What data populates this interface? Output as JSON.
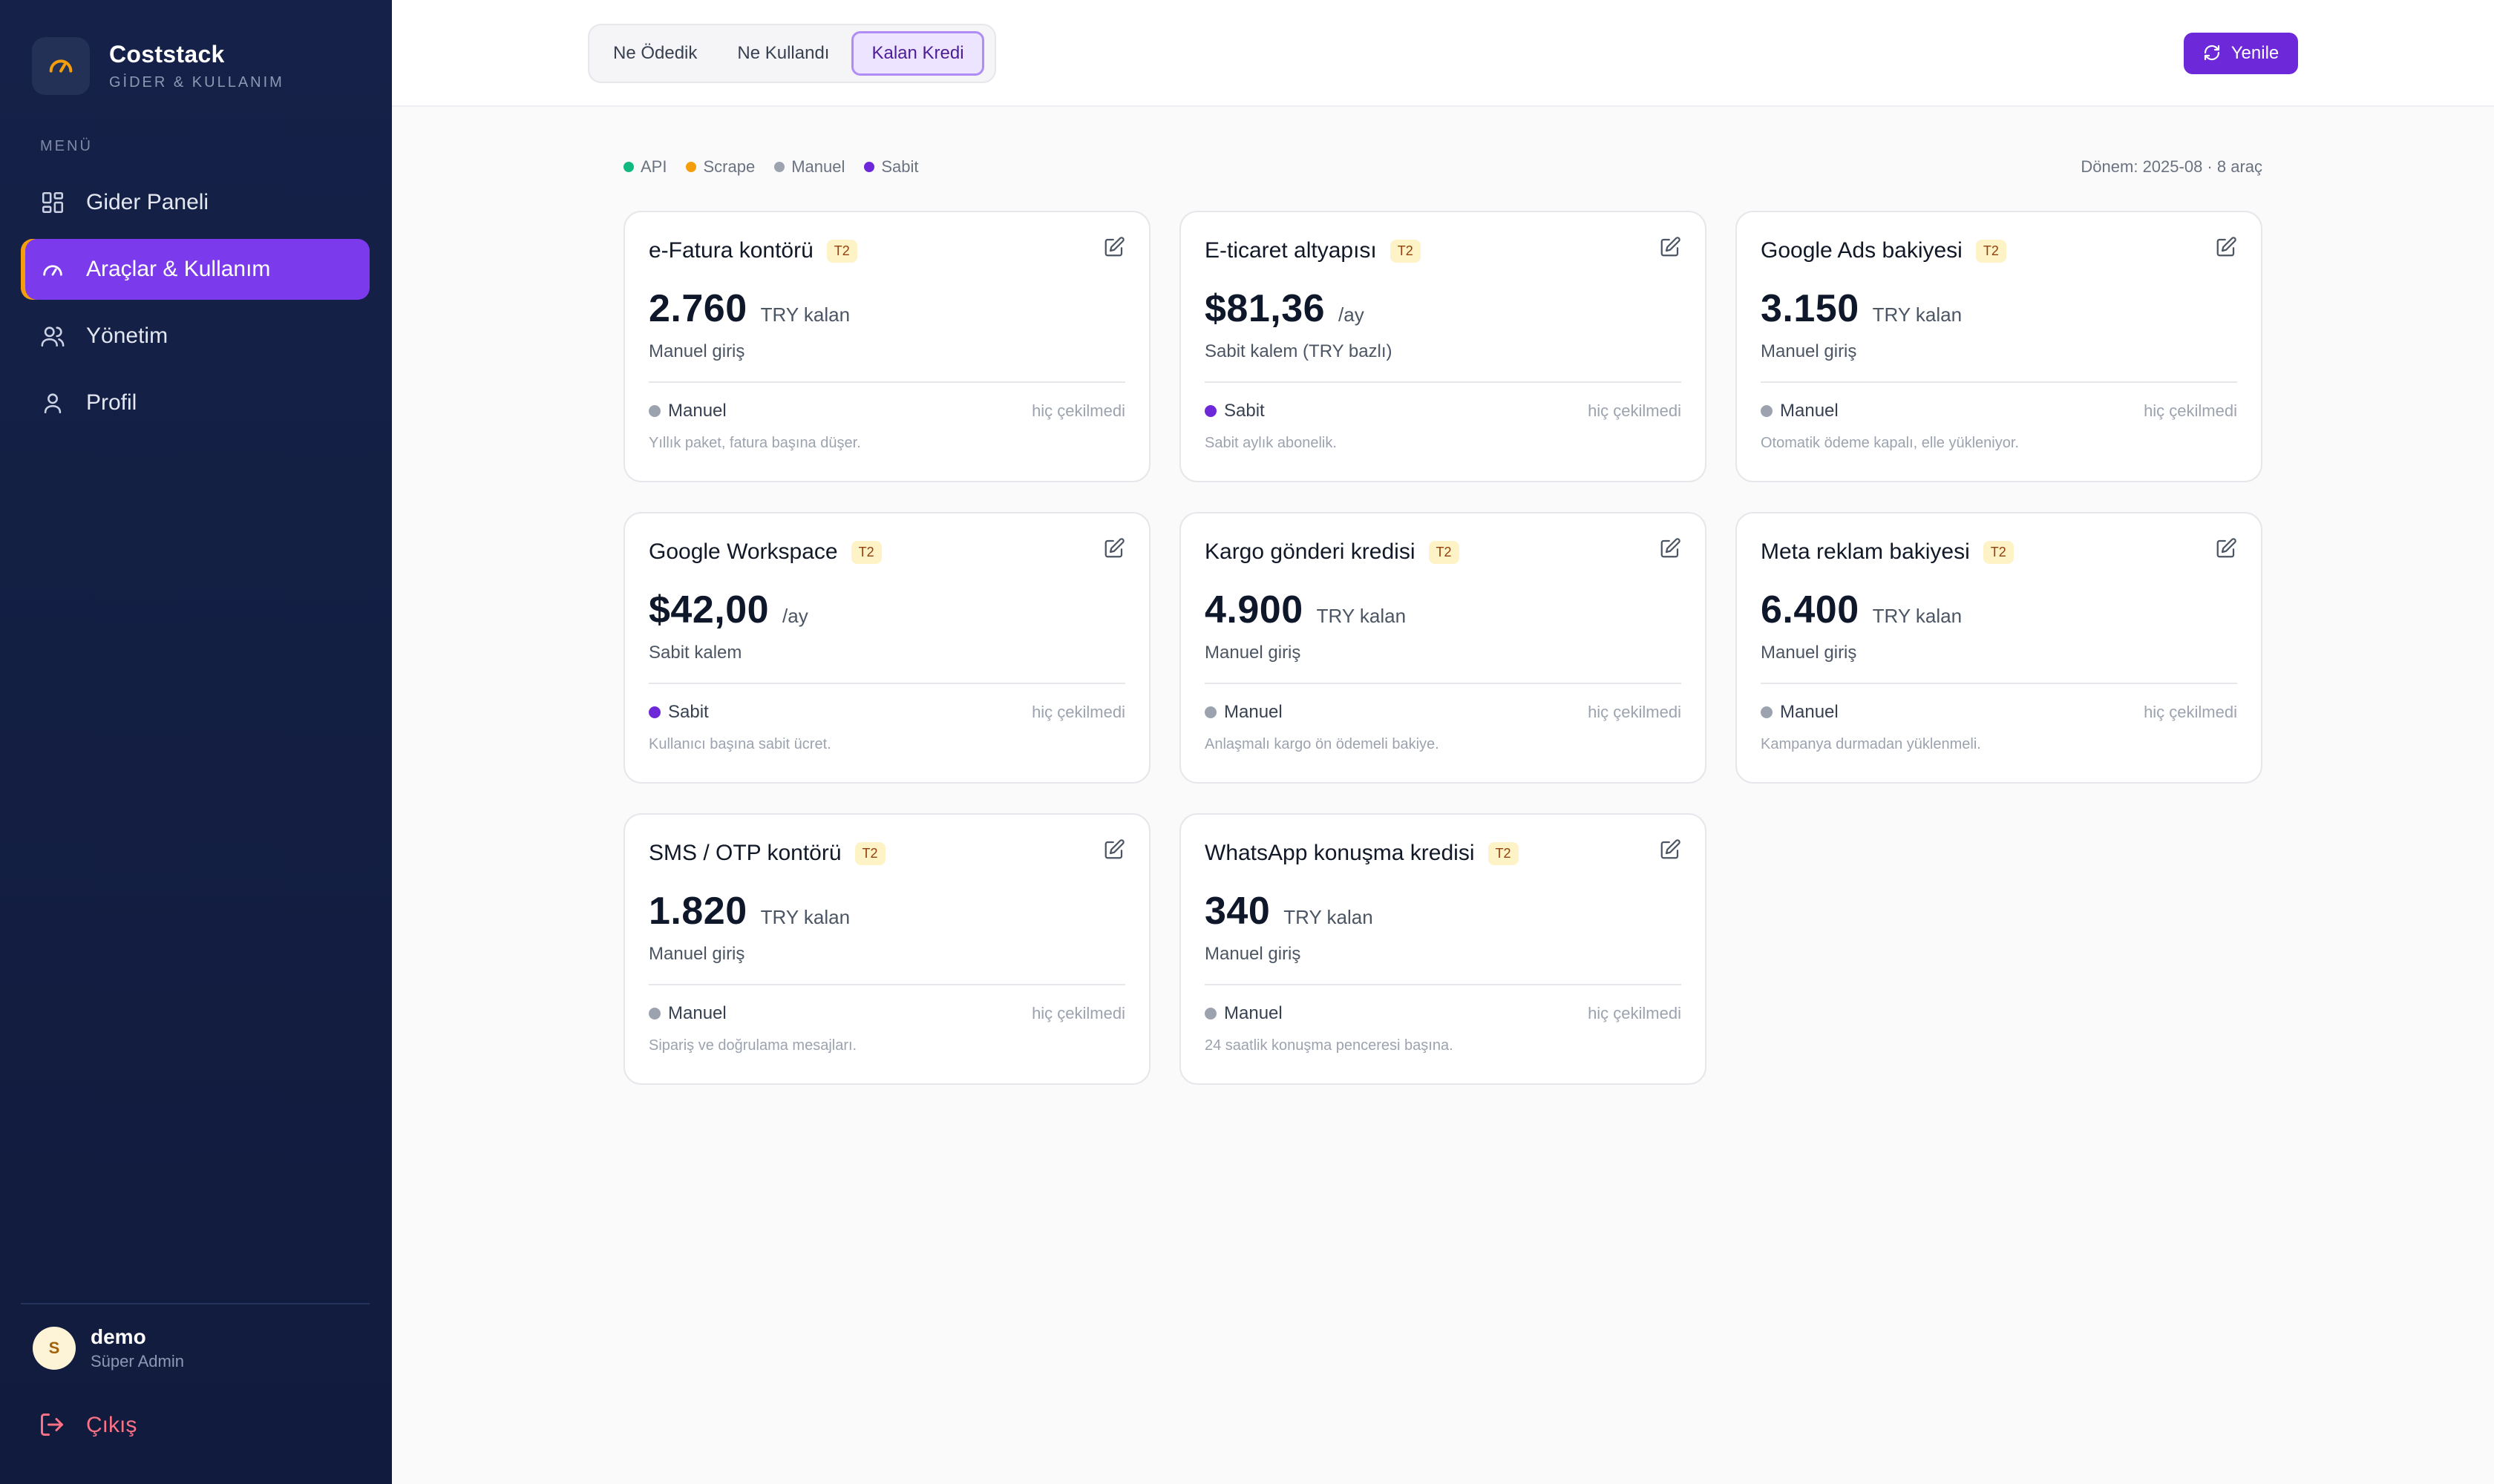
{
  "brand": {
    "name": "Coststack",
    "subtitle": "GİDER & KULLANIM"
  },
  "menu": {
    "title": "MENÜ",
    "items": [
      {
        "label": "Gider Paneli",
        "icon": "dashboard-grid-icon",
        "active": false
      },
      {
        "label": "Araçlar & Kullanım",
        "icon": "gauge-icon",
        "active": true
      },
      {
        "label": "Yönetim",
        "icon": "users-icon",
        "active": false
      },
      {
        "label": "Profil",
        "icon": "user-icon",
        "active": false
      }
    ]
  },
  "user": {
    "initial": "S",
    "name": "demo",
    "role": "Süper Admin"
  },
  "logout_label": "Çıkış",
  "tabs": [
    {
      "label": "Ne Ödedik",
      "active": false
    },
    {
      "label": "Ne Kullandı",
      "active": false
    },
    {
      "label": "Kalan Kredi",
      "active": true
    }
  ],
  "refresh_label": "Yenile",
  "legend": [
    {
      "label": "API",
      "color": "#10b981"
    },
    {
      "label": "Scrape",
      "color": "#f59e0b"
    },
    {
      "label": "Manuel",
      "color": "#9ca3af"
    },
    {
      "label": "Sabit",
      "color": "#6d28d9"
    }
  ],
  "period": "Dönem: 2025-08 · 8 araç",
  "cards": [
    {
      "title": "e-Fatura kontörü",
      "tier": "T2",
      "amount": "2.760",
      "unit": "TRY kalan",
      "subtitle": "Manuel giriş",
      "source": "Manuel",
      "source_color": "#9ca3af",
      "pulled": "hiç çekilmedi",
      "note": "Yıllık paket, fatura başına düşer."
    },
    {
      "title": "E-ticaret altyapısı",
      "tier": "T2",
      "amount": "$81,36",
      "unit": "/ay",
      "subtitle": "Sabit kalem (TRY bazlı)",
      "source": "Sabit",
      "source_color": "#6d28d9",
      "pulled": "hiç çekilmedi",
      "note": "Sabit aylık abonelik."
    },
    {
      "title": "Google Ads bakiyesi",
      "tier": "T2",
      "amount": "3.150",
      "unit": "TRY kalan",
      "subtitle": "Manuel giriş",
      "source": "Manuel",
      "source_color": "#9ca3af",
      "pulled": "hiç çekilmedi",
      "note": "Otomatik ödeme kapalı, elle yükleniyor."
    },
    {
      "title": "Google Workspace",
      "tier": "T2",
      "amount": "$42,00",
      "unit": "/ay",
      "subtitle": "Sabit kalem",
      "source": "Sabit",
      "source_color": "#6d28d9",
      "pulled": "hiç çekilmedi",
      "note": "Kullanıcı başına sabit ücret."
    },
    {
      "title": "Kargo gönderi kredisi",
      "tier": "T2",
      "amount": "4.900",
      "unit": "TRY kalan",
      "subtitle": "Manuel giriş",
      "source": "Manuel",
      "source_color": "#9ca3af",
      "pulled": "hiç çekilmedi",
      "note": "Anlaşmalı kargo ön ödemeli bakiye."
    },
    {
      "title": "Meta reklam bakiyesi",
      "tier": "T2",
      "amount": "6.400",
      "unit": "TRY kalan",
      "subtitle": "Manuel giriş",
      "source": "Manuel",
      "source_color": "#9ca3af",
      "pulled": "hiç çekilmedi",
      "note": "Kampanya durmadan yüklenmeli."
    },
    {
      "title": "SMS / OTP kontörü",
      "tier": "T2",
      "amount": "1.820",
      "unit": "TRY kalan",
      "subtitle": "Manuel giriş",
      "source": "Manuel",
      "source_color": "#9ca3af",
      "pulled": "hiç çekilmedi",
      "note": "Sipariş ve doğrulama mesajları."
    },
    {
      "title": "WhatsApp konuşma kredisi",
      "tier": "T2",
      "amount": "340",
      "unit": "TRY kalan",
      "subtitle": "Manuel giriş",
      "source": "Manuel",
      "source_color": "#9ca3af",
      "pulled": "hiç çekilmedi",
      "note": "24 saatlik konuşma penceresi başına."
    }
  ]
}
